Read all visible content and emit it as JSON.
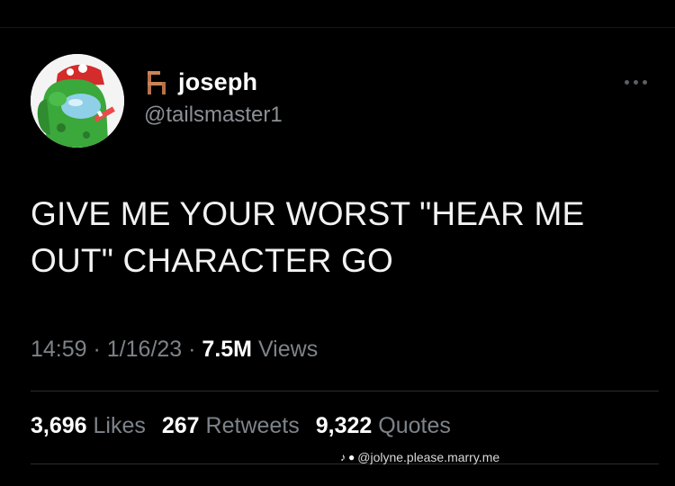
{
  "author": {
    "display_name": "joseph",
    "handle": "@tailsmaster1",
    "name_emoji": "chair-icon",
    "avatar": "among-us-character-avatar-icon"
  },
  "tweet": {
    "text_line1": "GIVE ME YOUR WORST \"HEAR ME",
    "text_line2": "OUT\" CHARACTER GO"
  },
  "meta": {
    "time": "14:59",
    "sep1": " · ",
    "date": "1/16/23",
    "sep2": " · ",
    "views_count": "7.5M",
    "views_label": " Views"
  },
  "stats": {
    "likes_count": "3,696",
    "likes_label": " Likes",
    "retweets_count": "267",
    "retweets_label": " Retweets",
    "quotes_count": "9,322",
    "quotes_label": " Quotes"
  },
  "watermark": {
    "text": "@jolyne.please.marry.me"
  },
  "colors": {
    "background": "#000000",
    "text_primary": "#ffffff",
    "text_secondary": "#7d8389",
    "avatar_green": "#3aa83a"
  }
}
